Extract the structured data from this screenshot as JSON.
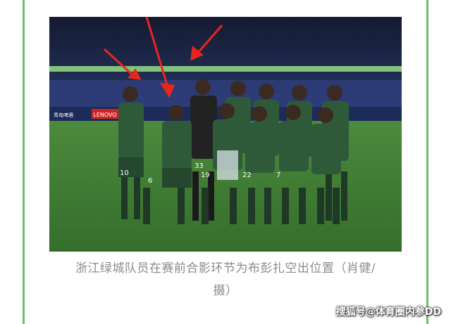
{
  "caption": {
    "line1": "浙江绿城队员在赛前合影环节为布彭扎空出位置（肖健/",
    "line2": "摄）"
  },
  "watermark": {
    "text": "搜狐号@体育圈内参DD"
  },
  "photo": {
    "ad_boards": [
      "青岛啤酒",
      "LENOVO"
    ],
    "jersey_numbers": [
      "10",
      "33",
      "6",
      "19",
      "22",
      "7"
    ]
  },
  "colors": {
    "border": "#6fbf6a",
    "caption_text": "#8b8b8b",
    "arrow": "#e8261c",
    "jersey": "#2e5a3a",
    "pitch": "#3f7a36"
  }
}
